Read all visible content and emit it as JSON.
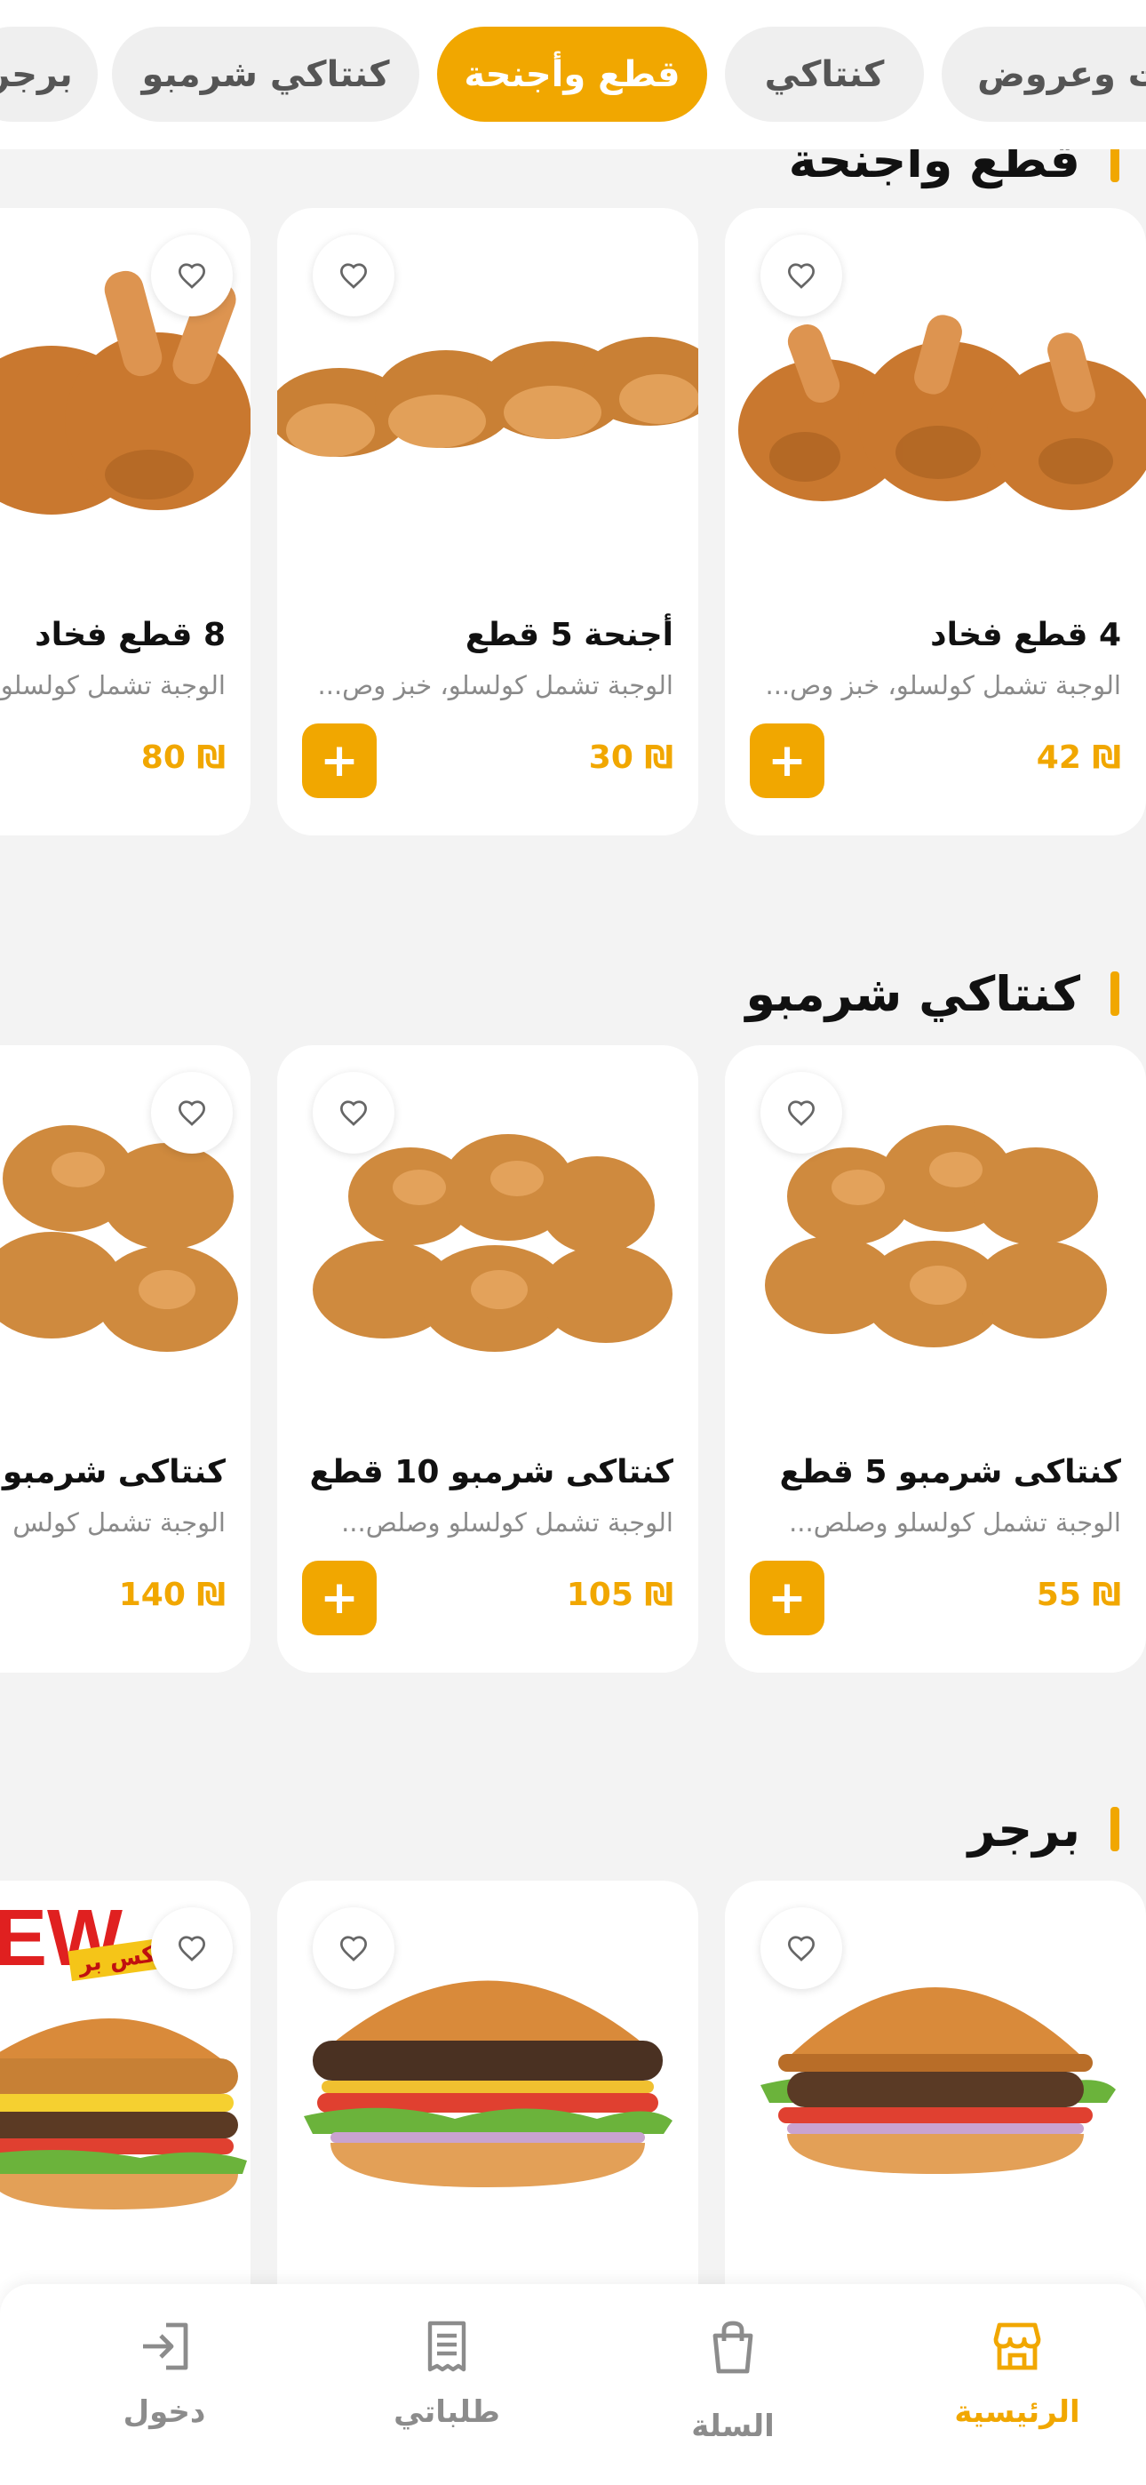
{
  "categories": [
    {
      "label": "برجر",
      "active": false
    },
    {
      "label": "كنتاكي شرمبو",
      "active": false
    },
    {
      "label": "قطع وأجنحة",
      "active": true
    },
    {
      "label": "كنتاكي",
      "active": false
    },
    {
      "label": "ت وعروض",
      "active": false
    }
  ],
  "sections": [
    {
      "title": "قطع وأجنحة",
      "items": [
        {
          "name": "4 قطع فخاد",
          "desc": "الوجبة تشمل كولسلو، خبز وص...",
          "price": "₪ 42",
          "add_label": "+"
        },
        {
          "name": "أجنحة 5 قطع",
          "desc": "الوجبة تشمل كولسلو، خبز وص...",
          "price": "₪ 30",
          "add_label": "+"
        },
        {
          "name": "8 قطع فخاد",
          "desc": "الوجبة تشمل كولسلو",
          "price": "₪ 80",
          "add_label": "+"
        }
      ]
    },
    {
      "title": "كنتاكي شرمبو",
      "items": [
        {
          "name": "كنتاكى شرمبو 5 قطع",
          "desc": "الوجبة تشمل كولسلو وصلص...",
          "price": "₪ 55",
          "add_label": "+"
        },
        {
          "name": "كنتاكى شرمبو 10 قطع",
          "desc": "الوجبة تشمل كولسلو وصلص...",
          "price": "₪ 105",
          "add_label": "+"
        },
        {
          "name": "كنتاكى شرمبو",
          "desc": "الوجبة تشمل كولس",
          "price": "₪ 140",
          "add_label": "+"
        }
      ]
    },
    {
      "title": "برجر",
      "items": [
        {
          "badge": ""
        },
        {
          "badge": ""
        },
        {
          "badge": "NEW",
          "badge_sub": "ميكس بر"
        }
      ]
    }
  ],
  "bottom_nav": [
    {
      "label": "الرئيسية",
      "icon": "store-icon",
      "active": true
    },
    {
      "label": "السلة",
      "icon": "shopping-bag-icon",
      "active": false
    },
    {
      "label": "طلباتي",
      "icon": "receipt-icon",
      "active": false
    },
    {
      "label": "دخول",
      "icon": "login-icon",
      "active": false
    }
  ],
  "colors": {
    "accent": "#f1a700",
    "background": "#f3f3f3",
    "card": "#ffffff"
  }
}
